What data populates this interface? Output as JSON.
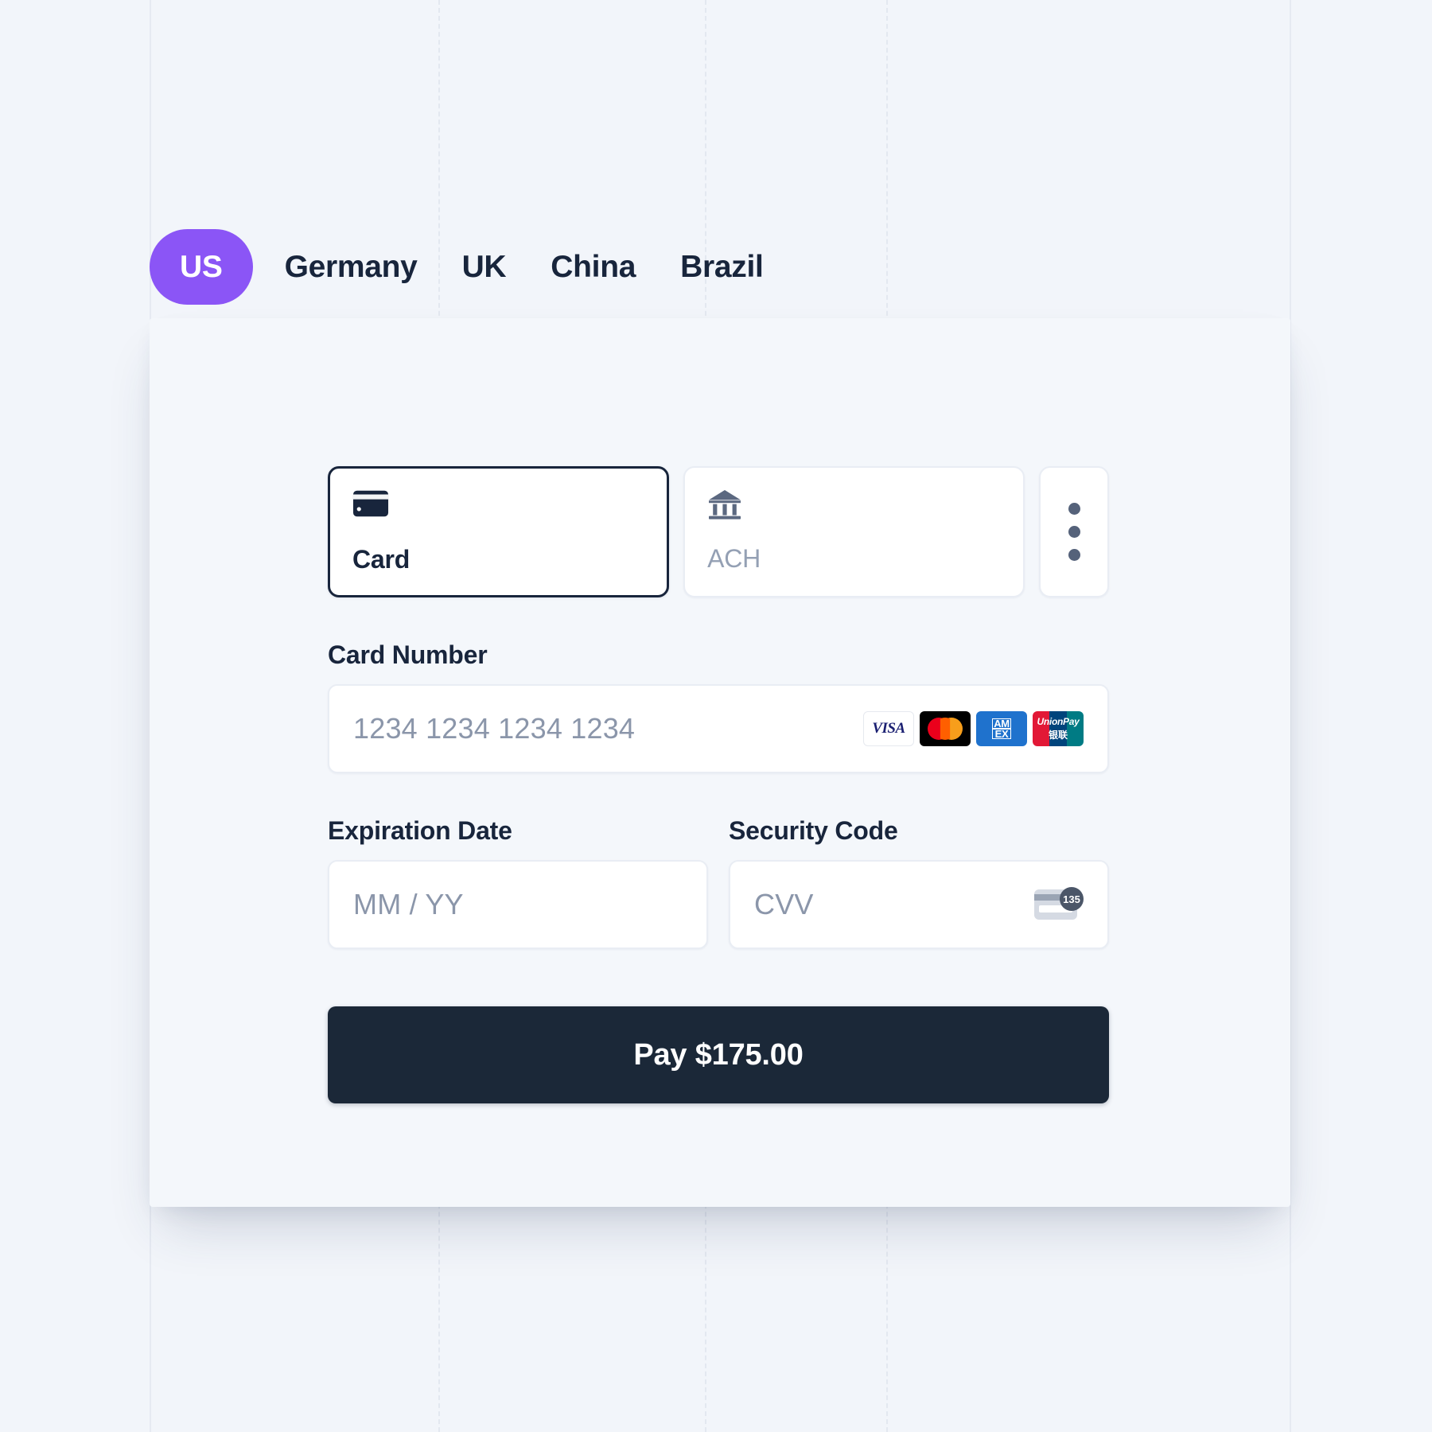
{
  "countries": {
    "tabs": [
      {
        "label": "US",
        "active": true
      },
      {
        "label": "Germany",
        "active": false
      },
      {
        "label": "UK",
        "active": false
      },
      {
        "label": "China",
        "active": false
      },
      {
        "label": "Brazil",
        "active": false
      }
    ],
    "active_color": "#8b55f6"
  },
  "payment_methods": {
    "card": {
      "label": "Card",
      "icon": "credit-card-icon",
      "selected": true
    },
    "ach": {
      "label": "ACH",
      "icon": "bank-icon",
      "selected": false
    },
    "more": {
      "icon": "more-vertical-icon"
    }
  },
  "fields": {
    "card_number": {
      "label": "Card Number",
      "placeholder": "1234 1234 1234 1234",
      "value": ""
    },
    "expiration": {
      "label": "Expiration Date",
      "placeholder": "MM / YY",
      "value": ""
    },
    "security_code": {
      "label": "Security Code",
      "placeholder": "CVV",
      "value": "",
      "hint_badge": "135"
    }
  },
  "brands": [
    {
      "name": "visa",
      "label": "VISA"
    },
    {
      "name": "mastercard",
      "label": ""
    },
    {
      "name": "amex",
      "label_top": "AM",
      "label_bottom": "EX"
    },
    {
      "name": "unionpay",
      "label_top": "UnionPay",
      "label_bottom": "银联"
    }
  ],
  "pay_button": {
    "label": "Pay $175.00",
    "amount": "175.00",
    "currency": "$",
    "bg_color": "#1b2838"
  }
}
